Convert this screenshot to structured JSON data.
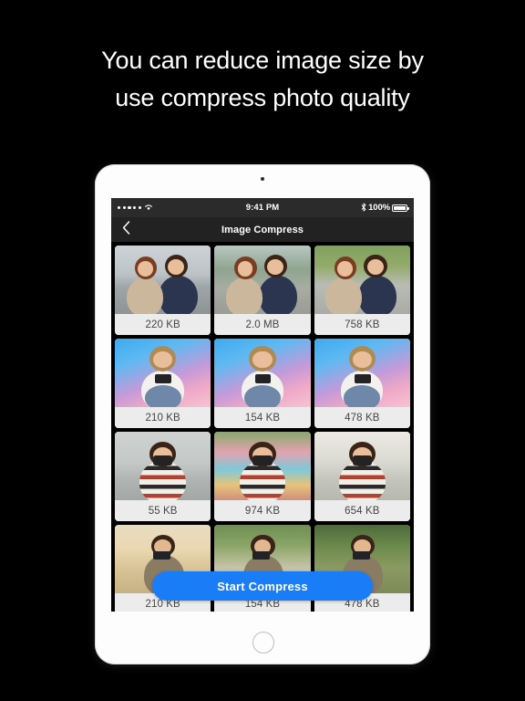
{
  "headline": {
    "line1": "You can reduce image size by",
    "line2": "use compress photo quality"
  },
  "colors": {
    "background": "#000000",
    "accent": "#1a7df8",
    "card_caption_bg": "#ececec",
    "caption_text": "#454545",
    "navbar_bg": "#222222",
    "statusbar_bg": "#2b2b2b",
    "device_body": "#fdfdfd"
  },
  "device": {
    "camera_dot": "camera-dot",
    "home_button": "home-button"
  },
  "statusbar": {
    "signal_dots": 5,
    "wifi_icon": "wifi-icon",
    "time": "9:41 PM",
    "bluetooth_icon": "bluetooth-icon",
    "battery_percent": "100%",
    "battery_icon": "battery-full-icon"
  },
  "navbar": {
    "back_icon": "chevron-left-icon",
    "title": "Image Compress"
  },
  "cta": {
    "label": "Start Compress"
  },
  "grid": {
    "items": [
      {
        "size": "220 KB",
        "scene": "sc-street",
        "alt": "two-women-selfie-city"
      },
      {
        "size": "2.0 MB",
        "scene": "sc-street2",
        "alt": "two-women-smiling-street"
      },
      {
        "size": "758 KB",
        "scene": "sc-park",
        "alt": "two-women-selfie-park"
      },
      {
        "size": "210 KB",
        "scene": "sc-grad",
        "alt": "woman-holding-camera-gradient"
      },
      {
        "size": "154 KB",
        "scene": "sc-grad",
        "alt": "woman-camera-eye-gradient"
      },
      {
        "size": "478 KB",
        "scene": "sc-grad",
        "alt": "woman-retro-camera-gradient"
      },
      {
        "size": "55 KB",
        "scene": "sc-wall",
        "alt": "woman-striped-shirt-camera"
      },
      {
        "size": "974 KB",
        "scene": "sc-fair",
        "alt": "woman-striped-shirt-fair"
      },
      {
        "size": "654 KB",
        "scene": "sc-bright",
        "alt": "woman-striped-shirt-backlit"
      },
      {
        "size": "210 KB",
        "scene": "sc-autumn",
        "alt": "person-photographing-autumn"
      },
      {
        "size": "154 KB",
        "scene": "sc-forest",
        "alt": "person-crouching-park-path"
      },
      {
        "size": "478 KB",
        "scene": "sc-darkgreen",
        "alt": "woman-glasses-holding-paper"
      }
    ]
  }
}
